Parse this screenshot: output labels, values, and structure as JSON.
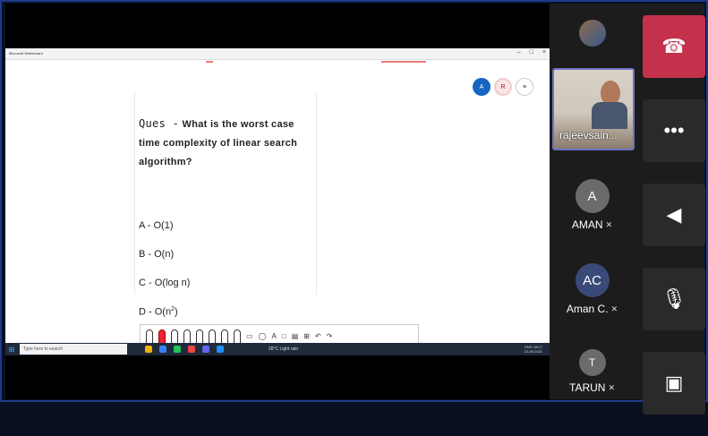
{
  "whiteboard": {
    "window_title": "Microsoft Whiteboard",
    "window_controls": [
      "–",
      "□",
      "×"
    ],
    "presence": [
      {
        "label": "A",
        "kind": "user-avatar"
      },
      {
        "label": "R",
        "kind": "user-avatar"
      },
      {
        "label": "≡",
        "kind": "menu"
      }
    ],
    "question": {
      "prefix": "Ques -",
      "text": "What is the worst case time complexity of linear search algorithm?"
    },
    "options": {
      "a": "A - O(1)",
      "b": "B - O(n)",
      "c": "C - O(log n)",
      "d_prefix": "D - O(n",
      "d_exp": "2",
      "d_suffix": ")"
    }
  },
  "taskbar": {
    "search_placeholder": "Type here to search",
    "weather": "28°C Light rain",
    "lang": "ENG",
    "time": "18:17",
    "date": "22-09-2021"
  },
  "participants": [
    {
      "name": "rajeevsain...",
      "video": true
    },
    {
      "name": "AMAN",
      "initials": "A",
      "color": "#6b6b6b",
      "muted": true
    },
    {
      "name": "Aman C.",
      "initials": "AC",
      "color": "#3a4a78",
      "muted": true
    },
    {
      "name": "TARUN",
      "initials": "T",
      "color": "#6b6b6b",
      "muted": true
    }
  ],
  "controls": [
    {
      "name": "hang-up",
      "glyph": "☎"
    },
    {
      "name": "more-options",
      "glyph": "•••"
    },
    {
      "name": "speaker",
      "glyph": "◀"
    },
    {
      "name": "mic-off",
      "glyph": "🎙"
    },
    {
      "name": "camera-off",
      "glyph": "▣"
    }
  ]
}
